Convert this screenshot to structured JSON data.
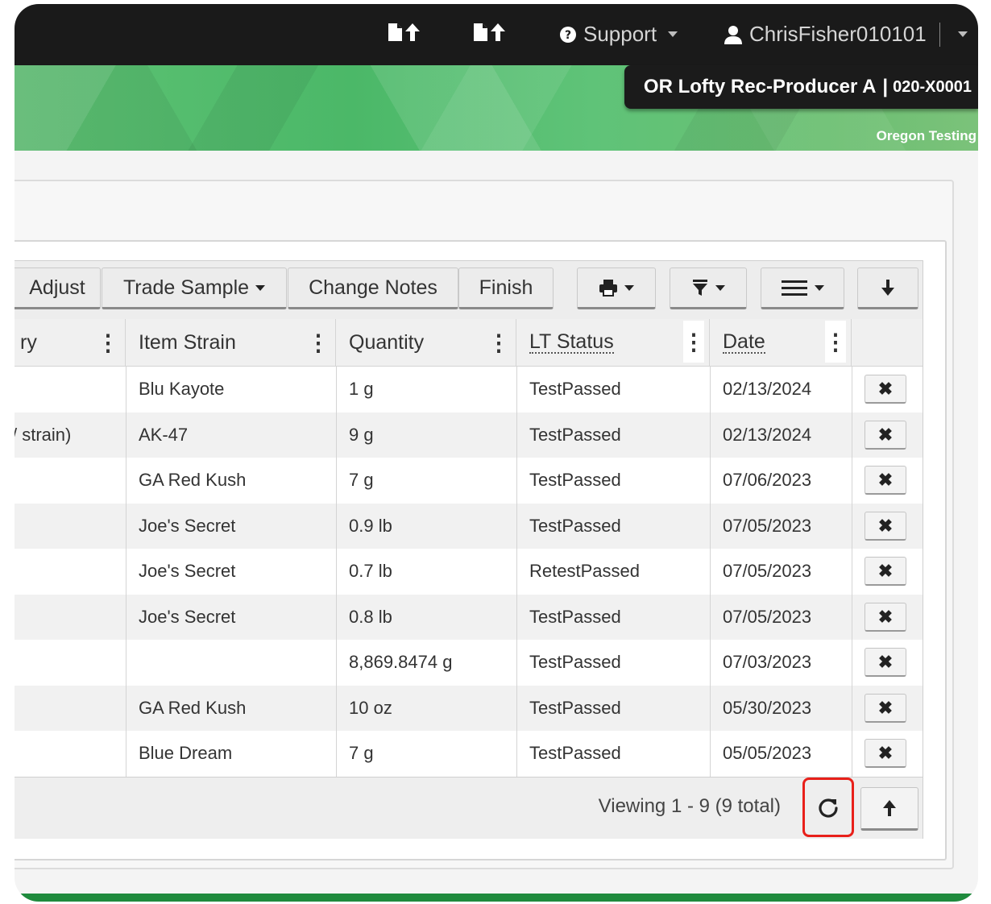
{
  "topnav": {
    "upload_icon_1": "file-upload-icon",
    "upload_icon_2": "file-upload-icon",
    "support_label": "Support",
    "user_label": "ChrisFisher010101"
  },
  "banner": {
    "facility_name": "OR Lofty Rec-Producer A",
    "facility_separator": "|",
    "license_number": "020-X0001",
    "testing_link": "Oregon Testing"
  },
  "toolbar": {
    "adjust_label": "Adjust",
    "trade_sample_label": "Trade Sample",
    "change_notes_label": "Change Notes",
    "finish_label": "Finish"
  },
  "columns": {
    "category_partial": "ry",
    "item_strain": "Item Strain",
    "quantity": "Quantity",
    "lt_status": "LT Status",
    "date": "Date"
  },
  "rows": [
    {
      "category": "",
      "strain": "Blu Kayote",
      "quantity": "1 g",
      "status": "TestPassed",
      "date": "02/13/2024"
    },
    {
      "category": "/ strain)",
      "strain": "AK-47",
      "quantity": "9 g",
      "status": "TestPassed",
      "date": "02/13/2024"
    },
    {
      "category": "",
      "strain": "GA Red Kush",
      "quantity": "7 g",
      "status": "TestPassed",
      "date": "07/06/2023"
    },
    {
      "category": "",
      "strain": "Joe's Secret",
      "quantity": "0.9 lb",
      "status": "TestPassed",
      "date": "07/05/2023"
    },
    {
      "category": "",
      "strain": "Joe's Secret",
      "quantity": "0.7 lb",
      "status": "RetestPassed",
      "date": "07/05/2023"
    },
    {
      "category": "",
      "strain": "Joe's Secret",
      "quantity": "0.8 lb",
      "status": "TestPassed",
      "date": "07/05/2023"
    },
    {
      "category": "",
      "strain": "",
      "quantity": "8,869.8474 g",
      "status": "TestPassed",
      "date": "07/03/2023"
    },
    {
      "category": "",
      "strain": "GA Red Kush",
      "quantity": "10 oz",
      "status": "TestPassed",
      "date": "05/30/2023"
    },
    {
      "category": "",
      "strain": "Blue Dream",
      "quantity": "7 g",
      "status": "TestPassed",
      "date": "05/05/2023"
    }
  ],
  "footer": {
    "viewing_text": "Viewing 1 - 9 (9 total)"
  },
  "colors": {
    "topbar": "#1a1a1a",
    "banner_green": "#4bb868",
    "highlight_red": "#e8201a"
  }
}
